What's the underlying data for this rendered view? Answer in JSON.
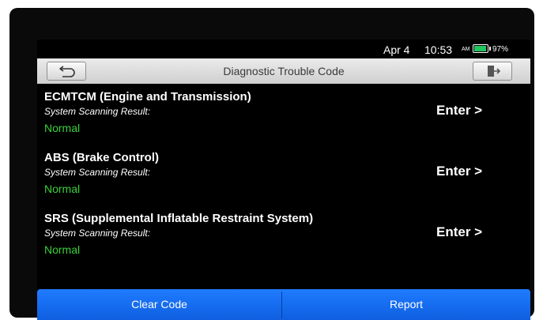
{
  "status_bar": {
    "date": "Apr 4",
    "time": "10:53",
    "ampm": "AM",
    "battery_percent": "97%",
    "battery_level": 0.97
  },
  "header": {
    "title": "Diagnostic Trouble Code",
    "back_icon": "back-arrow-icon",
    "exit_icon": "exit-door-icon"
  },
  "systems": [
    {
      "name": "ECMTCM (Engine and Transmission)",
      "scan_label": "System Scanning Result:",
      "status": "Normal",
      "action": "Enter >"
    },
    {
      "name": "ABS (Brake Control)",
      "scan_label": "System Scanning Result:",
      "status": "Normal",
      "action": "Enter >"
    },
    {
      "name": "SRS (Supplemental Inflatable Restraint System)",
      "scan_label": "System Scanning Result:",
      "status": "Normal",
      "action": "Enter >"
    }
  ],
  "bottom_bar": {
    "clear_label": "Clear Code",
    "report_label": "Report"
  },
  "colors": {
    "accent_blue": "#1f7bff",
    "status_normal": "#3ad13a",
    "background": "#000000"
  }
}
